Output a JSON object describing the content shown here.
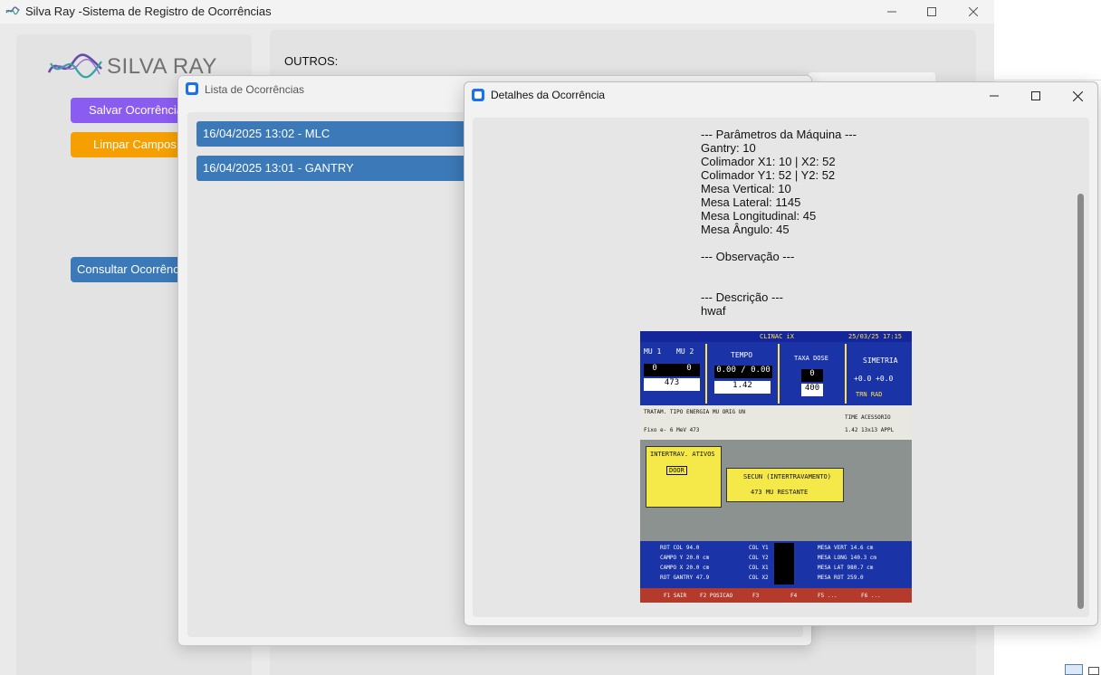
{
  "main_window": {
    "title": "Silva Ray -Sistema de Registro de Ocorrências"
  },
  "sidebar": {
    "logo_text": "SILVA RAY",
    "save_button": "Salvar Ocorrência",
    "clear_button": "Limpar Campos",
    "query_button": "Consultar Ocorrências"
  },
  "content": {
    "section_label": "OUTROS:"
  },
  "list_window": {
    "title": "Lista de Ocorrências",
    "items": [
      {
        "label": "16/04/2025 13:02 - MLC"
      },
      {
        "label": "16/04/2025 13:01 - GANTRY"
      }
    ]
  },
  "details_window": {
    "title": "Detalhes da Ocorrência",
    "lines": [
      "--- Parâmetros da Máquina ---",
      "Gantry: 10",
      "Colimador X1: 10 | X2: 52",
      "Colimador Y1: 52 | Y2: 52",
      "Mesa Vertical: 10",
      "Mesa Lateral: 1145",
      "Mesa Longitudinal: 45",
      "Mesa Ângulo: 45",
      "",
      "--- Observação ---",
      "",
      "",
      "--- Descrição ---",
      "hwaf"
    ]
  },
  "photo": {
    "machine": "CLINAC iX",
    "date": "25/03/25",
    "time": "17:15",
    "mu1_label": "MU 1",
    "mu2_label": "MU 2",
    "mu1_value": "0",
    "mu2_value": "0",
    "mu_total": "473",
    "tempo_label": "TEMPO",
    "tempo_value": "0.00 / 0.00",
    "tempo_total": "1.42",
    "taxa_label": "TAXA DOSE",
    "taxa_value": "0",
    "taxa_total": "400",
    "simetria_label": "SIMETRIA",
    "simetria_values": "+0.0  +0.0",
    "simetria_sub": "TRN   RAD",
    "table_header": "TRATAM. TIPO   ENERGIA  MU   ORIG UN",
    "table_row": "Fixo  e-  6 MeV  473",
    "time_label": "TIME  ACESSORIO",
    "time_row": "1.42 13x13 APPL",
    "interlock_header": "INTERTRAV. ATIVOS",
    "interlock_item": "DOOR",
    "secun_label": "SECUN   (INTERTRAVAMENTO)",
    "restante_label": "473 MU  RESTANTE",
    "bottom_rows": [
      "ROT COL     94.0",
      "CAMPO Y     20.0 cm",
      "CAMPO X     20.0 cm",
      "ROT GANTRY  47.9"
    ],
    "col_labels": [
      "COL Y1",
      "COL Y2",
      "COL X1",
      "COL X2"
    ],
    "mesa_rows": [
      "MESA VERT  14.6 cm",
      "MESA LONG 140.3 cm",
      "MESA LAT  980.7 cm",
      "MESA ROT  259.0"
    ],
    "fkeys": [
      "F1 SAIR",
      "F2 POSICAO",
      "F3",
      "F4",
      "F5 ...",
      "F6 ..."
    ]
  }
}
